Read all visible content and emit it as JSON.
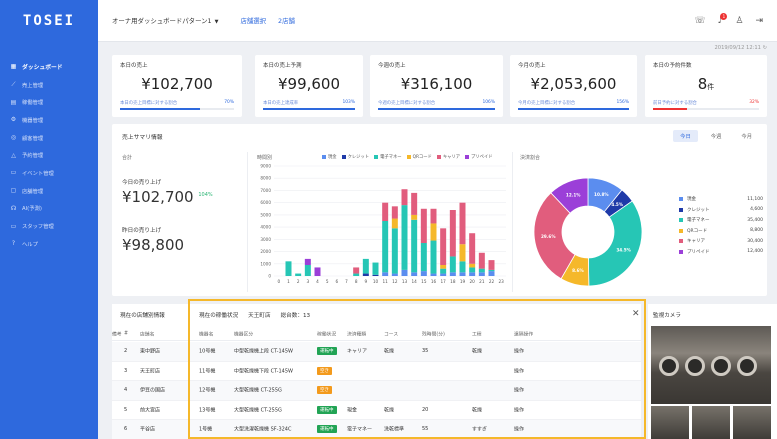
{
  "sidebar": {
    "logo": "TOSEI",
    "items": [
      {
        "icon": "▦",
        "label": "ダッシュボード",
        "active": true
      },
      {
        "icon": "⟋",
        "label": "売上管理"
      },
      {
        "icon": "▤",
        "label": "稼働管理"
      },
      {
        "icon": "⚙",
        "label": "機器管理"
      },
      {
        "icon": "◎",
        "label": "顧客管理"
      },
      {
        "icon": "△",
        "label": "予約管理"
      },
      {
        "icon": "▭",
        "label": "イベント管理"
      },
      {
        "icon": "▢",
        "label": "店舗管理"
      },
      {
        "icon": "☊",
        "label": "AI(予測)"
      },
      {
        "icon": "▭",
        "label": "スタッフ管理"
      },
      {
        "icon": "?",
        "label": "ヘルプ"
      }
    ]
  },
  "topbar": {
    "title": "オーナ用ダッシュボードパターン1",
    "store_select": "店舗選択",
    "store_name": "2店舗",
    "notification_count": "1"
  },
  "timestamp": "2019/09/12 12:11",
  "kpis": [
    {
      "label": "本日の売上",
      "value": "¥102,700",
      "unit": "",
      "sub": "本日の売上目標に対する割合",
      "pct": "70%",
      "fill": 0.7,
      "red": false
    },
    {
      "label": "本日の売上予測",
      "value": "¥99,600",
      "unit": "",
      "sub": "本日の売上達成率",
      "pct": "103%",
      "fill": 1.0,
      "red": false
    },
    {
      "label": "今週の売上",
      "value": "¥316,100",
      "unit": "",
      "sub": "今週の売上目標に対する割合",
      "pct": "106%",
      "fill": 1.0,
      "red": false
    },
    {
      "label": "今月の売上",
      "value": "¥2,053,600",
      "unit": "",
      "sub": "今月の売上目標に対する割合",
      "pct": "156%",
      "fill": 1.0,
      "red": false
    },
    {
      "label": "本日の予約件数",
      "value": "8",
      "unit": "件",
      "sub": "前日予約に対する割合",
      "pct": "32%",
      "fill": 0.32,
      "red": true
    }
  ],
  "summary": {
    "title": "売上サマリ情報",
    "periods": [
      "今日",
      "今週",
      "今月"
    ],
    "left_small": "合計",
    "today_label": "今日の売り上げ",
    "today_value": "¥102,700",
    "today_pct": "104%",
    "yesterday_label": "昨日の売り上げ",
    "yesterday_value": "¥98,800",
    "bar_title": "時間別",
    "pie_title": "決済割合"
  },
  "chart_data": [
    {
      "type": "bar",
      "stacked": true,
      "categories": [
        "0",
        "1",
        "2",
        "3",
        "4",
        "5",
        "6",
        "7",
        "8",
        "9",
        "10",
        "11",
        "12",
        "13",
        "14",
        "15",
        "16",
        "17",
        "18",
        "19",
        "20",
        "21",
        "22",
        "23"
      ],
      "ylim": [
        0,
        9000
      ],
      "yticks": [
        0,
        1000,
        2000,
        3000,
        4000,
        5000,
        6000,
        7000,
        8000,
        9000
      ],
      "series": [
        {
          "name": "現金",
          "color": "#5b8def",
          "values": [
            0,
            0,
            0,
            0,
            0,
            0,
            0,
            0,
            0,
            0,
            0,
            300,
            200,
            500,
            300,
            400,
            200,
            200,
            300,
            300,
            300,
            300,
            400,
            0
          ]
        },
        {
          "name": "クレジット",
          "color": "#1f3aa8",
          "values": [
            0,
            0,
            0,
            0,
            0,
            0,
            0,
            0,
            0,
            200,
            100,
            0,
            0,
            0,
            0,
            0,
            0,
            0,
            0,
            0,
            0,
            0,
            0,
            0
          ]
        },
        {
          "name": "電子マネー",
          "color": "#26c6b5",
          "values": [
            0,
            1200,
            200,
            900,
            0,
            0,
            0,
            0,
            200,
            1200,
            1000,
            4200,
            3700,
            5300,
            4300,
            2300,
            2700,
            400,
            1300,
            900,
            400,
            300,
            100,
            0
          ]
        },
        {
          "name": "QRコード",
          "color": "#f5b82a",
          "values": [
            0,
            0,
            0,
            0,
            0,
            0,
            0,
            0,
            0,
            0,
            0,
            0,
            800,
            0,
            400,
            0,
            1400,
            300,
            0,
            1400,
            300,
            0,
            0,
            0
          ]
        },
        {
          "name": "キャリア",
          "color": "#e15d7d",
          "values": [
            0,
            0,
            0,
            0,
            0,
            0,
            0,
            0,
            500,
            0,
            0,
            1500,
            1000,
            1300,
            1800,
            2800,
            1200,
            3000,
            3800,
            3400,
            2500,
            1300,
            800,
            0
          ]
        },
        {
          "name": "プリペイド",
          "color": "#9b3fd8",
          "values": [
            0,
            0,
            0,
            500,
            700,
            0,
            0,
            0,
            0,
            0,
            0,
            0,
            0,
            0,
            0,
            0,
            0,
            0,
            0,
            0,
            0,
            0,
            0,
            0
          ]
        }
      ]
    },
    {
      "type": "pie",
      "donut": true,
      "labels": [
        "現金",
        "クレジット",
        "電子マネー",
        "QRコード",
        "キャリア",
        "プリペイド"
      ],
      "values": [
        11100,
        4600,
        35400,
        8800,
        30400,
        12400
      ],
      "pct_labels": [
        "10.8%",
        "4.5%",
        "34.5%",
        "8.6%",
        "29.6%",
        "12.1%"
      ],
      "colors": [
        "#5b8def",
        "#1f3aa8",
        "#26c6b5",
        "#f5b82a",
        "#e15d7d",
        "#9b3fd8"
      ],
      "legend_values": [
        "11,100",
        "4,600",
        "35,400",
        "8,800",
        "30,400",
        "12,400"
      ]
    }
  ],
  "stores": {
    "title": "現在の店舗別情報",
    "headers": [
      "#",
      "店舗名"
    ],
    "rows": [
      [
        "2",
        "東中野店"
      ],
      [
        "3",
        "天王町店"
      ],
      [
        "4",
        "伊豆の国店"
      ],
      [
        "5",
        "前大宮店"
      ],
      [
        "6",
        "平谷店"
      ]
    ]
  },
  "status": {
    "title": "現在の稼働状況",
    "store": "天王町店",
    "total": "総台数：13",
    "headers": [
      "機器名",
      "機器区分",
      "稼働状況",
      "決済種類",
      "コース",
      "残時間(分)",
      "工程",
      "遠隔操作",
      "備考"
    ],
    "rows": [
      [
        "10号機",
        "中型乾燥機上段 CT-145W",
        "運転中",
        "キャリア",
        "乾燥",
        "35",
        "乾燥",
        "操作",
        ""
      ],
      [
        "11号機",
        "中型乾燥機下段 CT-145W",
        "空き",
        "",
        "",
        "",
        "",
        "操作",
        ""
      ],
      [
        "12号機",
        "大型乾燥機 CT-255G",
        "空き",
        "",
        "",
        "",
        "",
        "操作",
        ""
      ],
      [
        "13号機",
        "大型乾燥機 CT-255G",
        "運転中",
        "現金",
        "乾燥",
        "20",
        "乾燥",
        "操作",
        ""
      ],
      [
        "1号機",
        "大型洗濯乾燥機 SF-324C",
        "運転中",
        "電子マネー",
        "洗乾標準",
        "55",
        "すすぎ",
        "操作",
        ""
      ]
    ]
  },
  "camera": {
    "title": "監視カメラ"
  }
}
